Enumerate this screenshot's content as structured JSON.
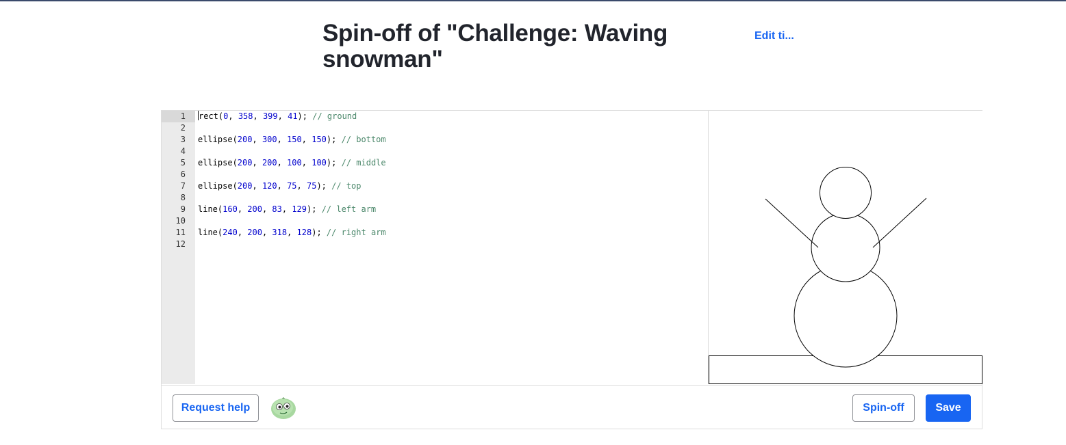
{
  "header": {
    "title": "Spin-off of \"Challenge: Waving snowman\"",
    "edit_link": "Edit ti..."
  },
  "editor": {
    "lines": [
      {
        "n": "1",
        "tokens": [
          {
            "t": "rect(",
            "c": "plain"
          },
          {
            "t": "0",
            "c": "num"
          },
          {
            "t": ", ",
            "c": "plain"
          },
          {
            "t": "358",
            "c": "num"
          },
          {
            "t": ", ",
            "c": "plain"
          },
          {
            "t": "399",
            "c": "num"
          },
          {
            "t": ", ",
            "c": "plain"
          },
          {
            "t": "41",
            "c": "num"
          },
          {
            "t": "); ",
            "c": "plain"
          },
          {
            "t": "// ground",
            "c": "cmt"
          }
        ]
      },
      {
        "n": "2",
        "tokens": []
      },
      {
        "n": "3",
        "tokens": [
          {
            "t": "ellipse(",
            "c": "plain"
          },
          {
            "t": "200",
            "c": "num"
          },
          {
            "t": ", ",
            "c": "plain"
          },
          {
            "t": "300",
            "c": "num"
          },
          {
            "t": ", ",
            "c": "plain"
          },
          {
            "t": "150",
            "c": "num"
          },
          {
            "t": ", ",
            "c": "plain"
          },
          {
            "t": "150",
            "c": "num"
          },
          {
            "t": "); ",
            "c": "plain"
          },
          {
            "t": "// bottom",
            "c": "cmt"
          }
        ]
      },
      {
        "n": "4",
        "tokens": []
      },
      {
        "n": "5",
        "tokens": [
          {
            "t": "ellipse(",
            "c": "plain"
          },
          {
            "t": "200",
            "c": "num"
          },
          {
            "t": ", ",
            "c": "plain"
          },
          {
            "t": "200",
            "c": "num"
          },
          {
            "t": ", ",
            "c": "plain"
          },
          {
            "t": "100",
            "c": "num"
          },
          {
            "t": ", ",
            "c": "plain"
          },
          {
            "t": "100",
            "c": "num"
          },
          {
            "t": "); ",
            "c": "plain"
          },
          {
            "t": "// middle",
            "c": "cmt"
          }
        ]
      },
      {
        "n": "6",
        "tokens": []
      },
      {
        "n": "7",
        "tokens": [
          {
            "t": "ellipse(",
            "c": "plain"
          },
          {
            "t": "200",
            "c": "num"
          },
          {
            "t": ", ",
            "c": "plain"
          },
          {
            "t": "120",
            "c": "num"
          },
          {
            "t": ", ",
            "c": "plain"
          },
          {
            "t": "75",
            "c": "num"
          },
          {
            "t": ", ",
            "c": "plain"
          },
          {
            "t": "75",
            "c": "num"
          },
          {
            "t": "); ",
            "c": "plain"
          },
          {
            "t": "// top",
            "c": "cmt"
          }
        ]
      },
      {
        "n": "8",
        "tokens": []
      },
      {
        "n": "9",
        "tokens": [
          {
            "t": "line(",
            "c": "plain"
          },
          {
            "t": "160",
            "c": "num"
          },
          {
            "t": ", ",
            "c": "plain"
          },
          {
            "t": "200",
            "c": "num"
          },
          {
            "t": ", ",
            "c": "plain"
          },
          {
            "t": "83",
            "c": "num"
          },
          {
            "t": ", ",
            "c": "plain"
          },
          {
            "t": "129",
            "c": "num"
          },
          {
            "t": "); ",
            "c": "plain"
          },
          {
            "t": "// left arm",
            "c": "cmt"
          }
        ]
      },
      {
        "n": "10",
        "tokens": []
      },
      {
        "n": "11",
        "tokens": [
          {
            "t": "line(",
            "c": "plain"
          },
          {
            "t": "240",
            "c": "num"
          },
          {
            "t": ", ",
            "c": "plain"
          },
          {
            "t": "200",
            "c": "num"
          },
          {
            "t": ", ",
            "c": "plain"
          },
          {
            "t": "318",
            "c": "num"
          },
          {
            "t": ", ",
            "c": "plain"
          },
          {
            "t": "128",
            "c": "num"
          },
          {
            "t": "); ",
            "c": "plain"
          },
          {
            "t": "// right arm",
            "c": "cmt"
          }
        ]
      },
      {
        "n": "12",
        "tokens": []
      }
    ]
  },
  "footer": {
    "request_help": "Request help",
    "spin_off": "Spin-off",
    "save": "Save",
    "avatar_icon": "avatar-icon"
  },
  "colors": {
    "accent": "#1865f2",
    "number": "#0000cd",
    "comment": "#4c886b",
    "gutter": "#ebebeb"
  }
}
